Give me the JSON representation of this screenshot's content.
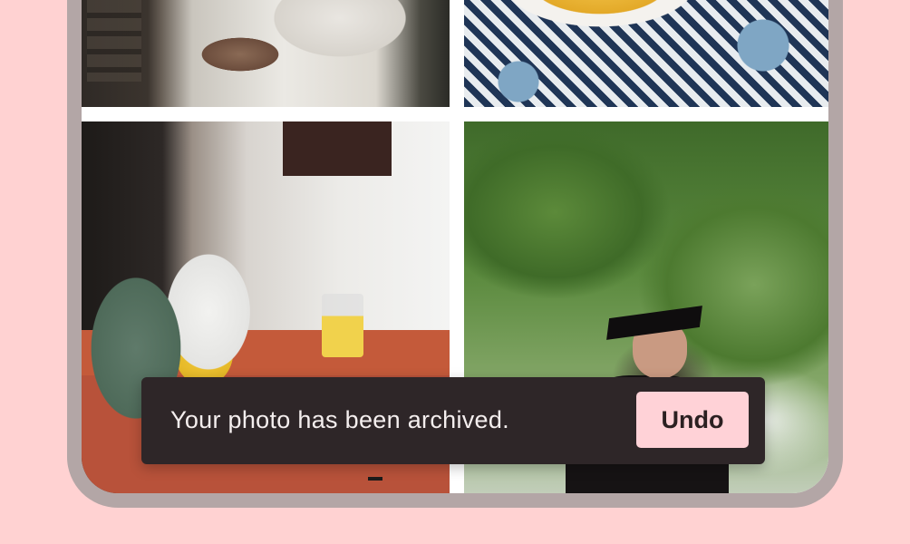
{
  "snackbar": {
    "message": "Your photo has been archived.",
    "action_label": "Undo"
  },
  "photos": [
    {
      "name": "photo-cook-tattoo"
    },
    {
      "name": "photo-chips-plate"
    },
    {
      "name": "photo-kitchen"
    },
    {
      "name": "photo-graduate-tree"
    }
  ],
  "colors": {
    "background": "#ffd2d2",
    "device_frame": "#b3a6a6",
    "snackbar_bg": "#2e2628",
    "snackbar_text": "#f4eeee",
    "action_bg": "#ffd2d7"
  }
}
